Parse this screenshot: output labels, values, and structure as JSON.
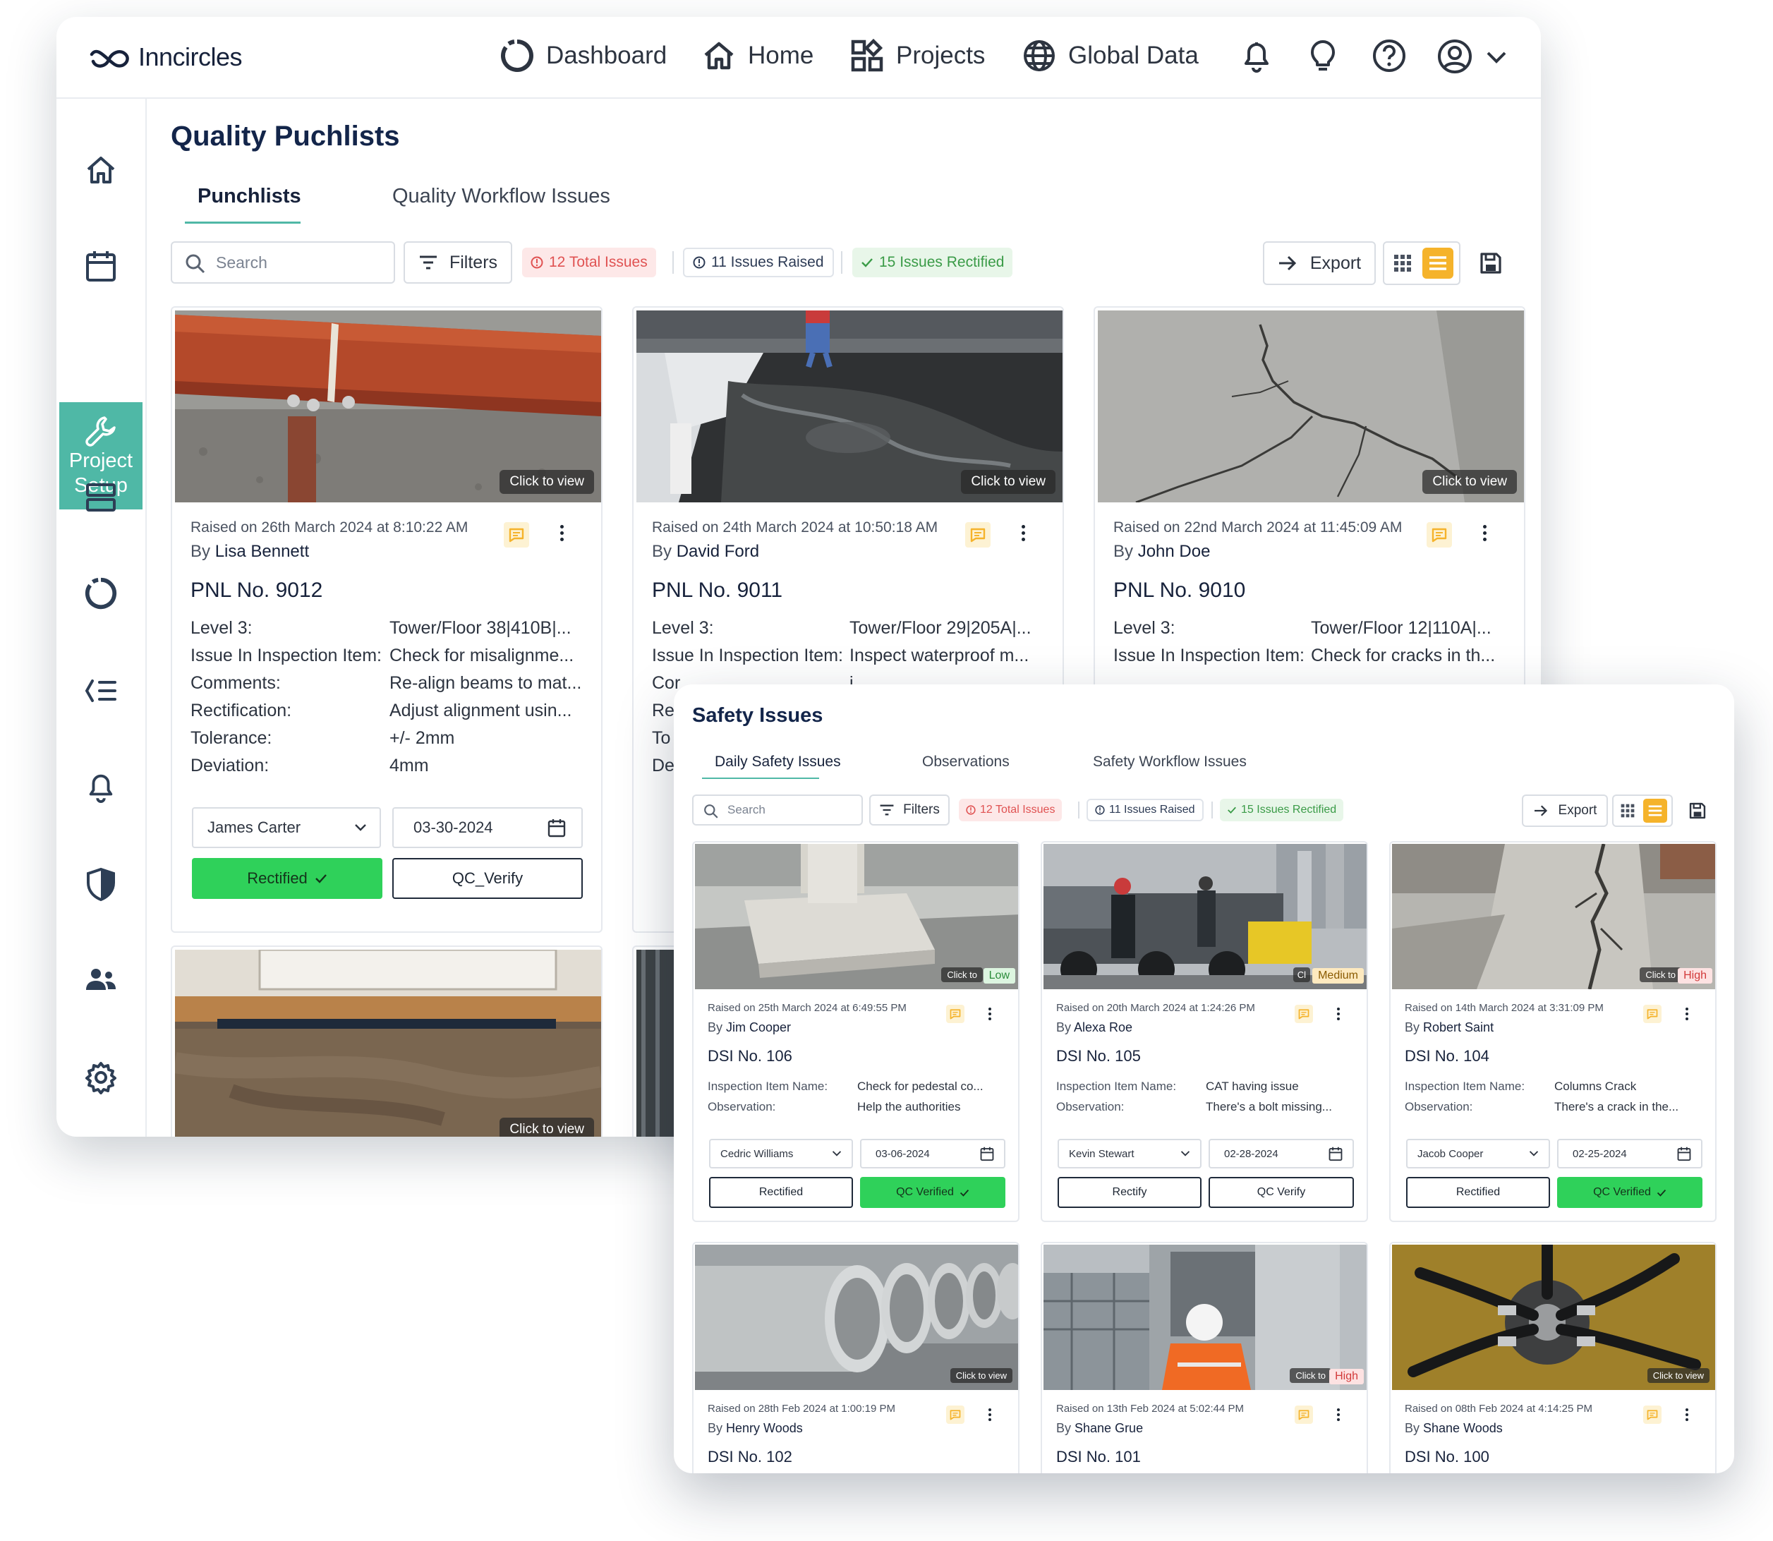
{
  "app": {
    "brand": "Inncircles",
    "nav": [
      "Dashboard",
      "Home",
      "Projects",
      "Global Data"
    ]
  },
  "colors": {
    "accent": "#4fb8a6",
    "navy": "#13254a",
    "green": "#2fd15a",
    "orange": "#f5b32b",
    "red": "#e05252"
  },
  "sidebar": {
    "active_label_1": "Project",
    "active_label_2": "Setup",
    "icons": [
      "home-icon",
      "calendar-icon",
      "wrench-icon",
      "stack-icon",
      "ring-icon",
      "list-icon",
      "bell-icon",
      "shield-icon",
      "users-icon",
      "gear-icon"
    ]
  },
  "quality": {
    "title": "Quality Puchlists",
    "tabs": [
      "Punchlists",
      "Quality Workflow Issues"
    ],
    "search_placeholder": "Search",
    "filters": "Filters",
    "total": "12 Total Issues",
    "raised": "11 Issues Raised",
    "rectified": "15 Issues Rectified",
    "export": "Export",
    "click_to_view": "Click to view",
    "cards": [
      {
        "raised": "Raised on 26th March 2024 at 8:10:22 AM",
        "by": "Lisa Bennett",
        "pnl": "PNL No. 9012",
        "rows": [
          [
            "Level 3:",
            "Tower/Floor 38|410B|..."
          ],
          [
            "Issue In Inspection Item:",
            "Check for misalignme..."
          ],
          [
            "Comments:",
            "Re-align beams to mat..."
          ],
          [
            "Rectification:",
            "Adjust alignment usin..."
          ],
          [
            "Tolerance:",
            "+/- 2mm"
          ],
          [
            "Deviation:",
            "4mm"
          ]
        ],
        "assignee": "James Carter",
        "date": "03-30-2024",
        "btn1": "Rectified",
        "btn2": "QC_Verify"
      },
      {
        "raised": "Raised on 24th March 2024 at 10:50:18 AM",
        "by": "David Ford",
        "pnl": "PNL No. 9011",
        "rows": [
          [
            "Level 3:",
            "Tower/Floor 29|205A|..."
          ],
          [
            "Issue In Inspection Item:",
            "Inspect waterproof m..."
          ],
          [
            "Cor",
            "i"
          ],
          [
            "Re",
            ""
          ],
          [
            "To",
            ""
          ],
          [
            "De",
            ""
          ]
        ]
      },
      {
        "raised": "Raised on 22nd March 2024 at 11:45:09 AM",
        "by": "John Doe",
        "pnl": "PNL No. 9010",
        "rows": [
          [
            "Level 3:",
            "Tower/Floor 12|110A|..."
          ],
          [
            "Issue In Inspection Item:",
            "Check for cracks in th..."
          ]
        ]
      }
    ]
  },
  "safety": {
    "title": "Safety Issues",
    "tabs": [
      "Daily Safety Issues",
      "Observations",
      "Safety Workflow Issues"
    ],
    "search_placeholder": "Search",
    "filters": "Filters",
    "total": "12 Total Issues",
    "raised": "11 Issues Raised",
    "rectified": "15 Issues Rectified",
    "export": "Export",
    "click_to_view": "Click to view",
    "click_to_short": "Click to",
    "inspection_label": "Inspection Item Name:",
    "observation_label": "Observation:",
    "cards": [
      {
        "raised": "Raised on 25th March 2024 at 6:49:55 PM",
        "by": "Jim Cooper",
        "dsi": "DSI No. 106",
        "item": "Check for pedestal co...",
        "obs": "Help the authorities",
        "assignee": "Cedric Williams",
        "date": "03-06-2024",
        "btn1": "Rectified",
        "btn2": "QC Verified",
        "priority": "Low"
      },
      {
        "raised": "Raised on 20th March 2024 at 1:24:26 PM",
        "by": "Alexa Roe",
        "dsi": "DSI No. 105",
        "item": "CAT having issue",
        "obs": "There's a bolt missing...",
        "assignee": "Kevin Stewart",
        "date": "02-28-2024",
        "btn1": "Rectify",
        "btn2": "QC Verify",
        "priority": "Medium",
        "click": "Cl"
      },
      {
        "raised": "Raised on 14th March 2024 at 3:31:09 PM",
        "by": "Robert Saint",
        "dsi": "DSI No. 104",
        "item": "Columns Crack",
        "obs": "There's a crack in the...",
        "assignee": "Jacob Cooper",
        "date": "02-25-2024",
        "btn1": "Rectified",
        "btn2": "QC Verified",
        "priority": "High"
      },
      {
        "raised": "Raised on 28th Feb 2024 at 1:00:19 PM",
        "by": "Henry Woods",
        "dsi": "DSI No. 102"
      },
      {
        "raised": "Raised on 13th Feb 2024 at 5:02:44 PM",
        "by": "Shane Grue",
        "dsi": "DSI No. 101",
        "priority": "High"
      },
      {
        "raised": "Raised on 08th Feb 2024 at 4:14:25 PM",
        "by": "Shane Woods",
        "dsi": "DSI No. 100"
      }
    ]
  }
}
